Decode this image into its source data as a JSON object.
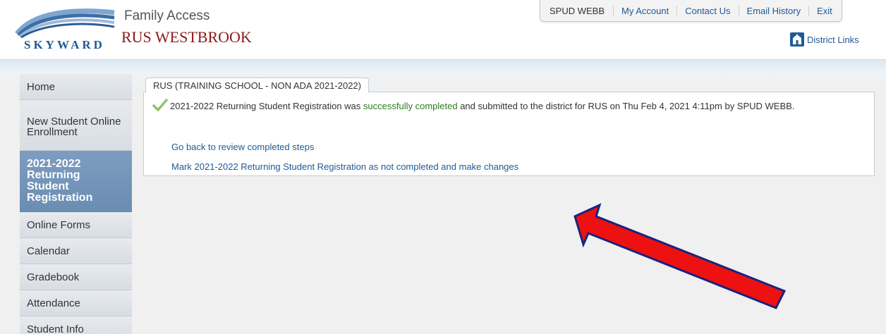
{
  "header": {
    "logo_text": "SKYWARD",
    "app_title": "Family Access",
    "school_name": "RUS WESTBROOK",
    "district_links": "District Links"
  },
  "topnav": {
    "user": "SPUD WEBB",
    "links": [
      "My Account",
      "Contact Us",
      "Email History",
      "Exit"
    ]
  },
  "sidebar": {
    "items": [
      {
        "label": "Home"
      },
      {
        "label": "New Student Online Enrollment"
      },
      {
        "label": "2021-2022 Returning Student Registration",
        "active": true
      },
      {
        "label": "Online Forms"
      },
      {
        "label": "Calendar"
      },
      {
        "label": "Gradebook"
      },
      {
        "label": "Attendance"
      },
      {
        "label": "Student Info"
      }
    ]
  },
  "main": {
    "tab_label": "RUS (TRAINING SCHOOL - NON ADA 2021-2022)",
    "message_prefix": "2021-2022 Returning Student Registration was ",
    "message_success": "successfully completed",
    "message_suffix": " and submitted to the district for RUS on Thu Feb 4, 2021 4:11pm by SPUD WEBB.",
    "link_review": "Go back to review completed steps",
    "link_mark_incomplete": "Mark 2021-2022 Returning Student Registration as not completed and make changes"
  },
  "colors": {
    "brand_blue": "#1f5a94",
    "school_red": "#8b1a1a",
    "success_green": "#2e7d1f",
    "active_nav": "#7497bc",
    "annotation_arrow": "#ee1111"
  },
  "icons": [
    "skyward-logo",
    "district-links-icon",
    "success-check-icon",
    "annotation-arrow"
  ]
}
